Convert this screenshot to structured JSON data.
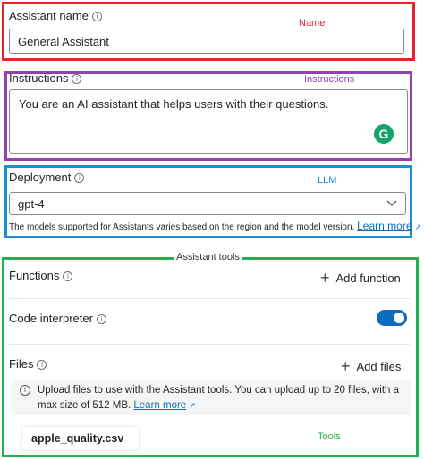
{
  "annotations": {
    "name": "Name",
    "instructions": "Instructions",
    "llm": "LLM",
    "assistant_tools": "Assistant tools",
    "tools": "Tools",
    "colors": {
      "name": "#e1262a",
      "instructions": "#8e44ad",
      "llm": "#1a8fd6",
      "tools": "#21b24a"
    }
  },
  "assistant_name": {
    "label": "Assistant name",
    "value": "General Assistant"
  },
  "instructions": {
    "label": "Instructions",
    "value": "You are an AI assistant that helps users with their questions."
  },
  "deployment": {
    "label": "Deployment",
    "selected": "gpt-4",
    "help_text": "The models supported for Assistants varies based on the region and the model version.",
    "learn_more": "Learn more"
  },
  "tools": {
    "functions": {
      "label": "Functions",
      "add_label": "Add function"
    },
    "code_interpreter": {
      "label": "Code interpreter",
      "enabled": true
    },
    "files": {
      "label": "Files",
      "add_label": "Add files",
      "banner_text": "Upload files to use with the Assistant tools. You can upload up to 20 files, with a max size of 512 MB.",
      "learn_more": "Learn more",
      "items": [
        {
          "name": "apple_quality.csv"
        }
      ]
    }
  },
  "icons": {
    "info": "info-icon",
    "chevron": "chevron-down-icon",
    "plus": "plus-icon",
    "delete": "trash-icon",
    "external": "external-link-icon",
    "grammarly": "grammarly-icon"
  }
}
